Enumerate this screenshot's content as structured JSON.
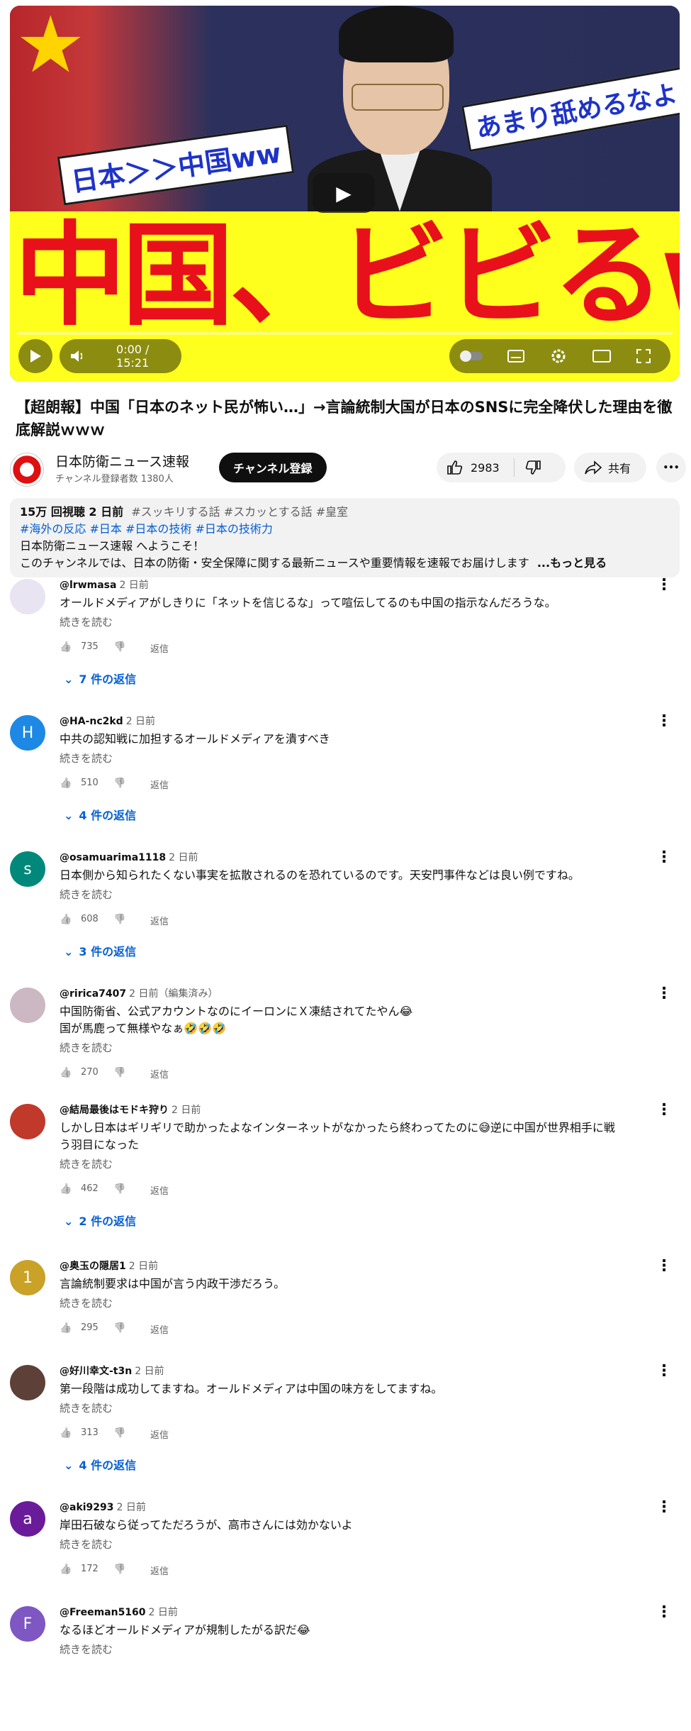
{
  "video": {
    "flag_glyph": "★",
    "tag_left": "日本＞＞中国ww",
    "tag_right": "あまり舐めるなよ！",
    "banner_text": "中国、ビビるww",
    "play_glyph": "▶",
    "time": "0:00 / 15:21"
  },
  "title": "【超朗報】中国「日本のネット民が怖い…」→言論統制大国が日本のSNSに完全降伏した理由を徹底解説ｗｗｗ",
  "channel": {
    "name": "日本防衛ニュース速報",
    "subscribers": "チャンネル登録者数 1380人",
    "subscribe_label": "チャンネル登録",
    "likes": "2983",
    "share_label": "共有",
    "more_glyph": "•••"
  },
  "description": {
    "stats": "15万 回視聴  2 日前",
    "tags_line1": "#スッキリする話 #スカッとする話 #皇室",
    "tags_line2": "#海外の反応 #日本 #日本の技術 #日本の技術力",
    "line3": "日本防衛ニュース速報 へようこそ！",
    "line4": " このチャンネルでは、日本の防衛・安全保障に関する最新ニュースや重要情報を速報でお届けします",
    "more": "...もっと見る"
  },
  "comment_ui": {
    "read_more": "続きを読む",
    "reply_label": "返信",
    "kebab": "⋮",
    "like_icon": "👍",
    "dislike_icon": "👎",
    "chevron": "⌄"
  },
  "comments": [
    {
      "user": "@lrwmasa",
      "ago": "2 日前",
      "text": "オールドメディアがしきりに「ネットを信じるな」って喧伝してるのも中国の指示なんだろうな。",
      "likes": "735",
      "replies": "7 件の返信",
      "avatar": "",
      "avatar_color": "#e9e4f2"
    },
    {
      "user": "@HA-nc2kd",
      "ago": "2 日前",
      "text": "中共の認知戦に加担するオールドメディアを潰すべき",
      "likes": "510",
      "replies": "4 件の返信",
      "avatar": "H",
      "avatar_color": "#1e88e5"
    },
    {
      "user": "@osamuarima1118",
      "ago": "2 日前",
      "text": "日本側から知られたくない事実を拡散されるのを恐れているのです。天安門事件などは良い例ですね。",
      "likes": "608",
      "replies": "3 件の返信",
      "avatar": "s",
      "avatar_color": "#00897b"
    },
    {
      "user": "@ririca7407",
      "ago": "2 日前（編集済み）",
      "text": "中国防衛省、公式アカウントなのにイーロンにＸ凍結されてたやん😂",
      "text2": "国が馬鹿って無様やなぁ🤣🤣🤣",
      "likes": "270",
      "replies": "",
      "avatar": "",
      "avatar_color": "#cbb8c2"
    },
    {
      "user": "@結局最後はモドキ狩り",
      "ago": "2 日前",
      "text": "しかし日本はギリギリで助かったよなインターネットがなかったら終わってたのに😅逆に中国が世界相手に戦",
      "text2": "う羽目になった",
      "likes": "462",
      "replies": "2 件の返信",
      "avatar": "",
      "avatar_color": "#c0392b"
    },
    {
      "user": "@奥玉の隠居1",
      "ago": "2 日前",
      "text": "言論統制要求は中国が言う内政干渉だろう。",
      "likes": "295",
      "replies": "",
      "avatar": "1",
      "avatar_color": "#c9a227"
    },
    {
      "user": "@好川幸文-t3n",
      "ago": "2 日前",
      "text": "第一段階は成功してますね。オールドメディアは中国の味方をしてますね。",
      "likes": "313",
      "replies": "4 件の返信",
      "avatar": "",
      "avatar_color": "#5d4037"
    },
    {
      "user": "@aki9293",
      "ago": "2 日前",
      "text": "岸田石破なら従ってただろうが、高市さんには効かないよ",
      "likes": "172",
      "replies": "",
      "avatar": "a",
      "avatar_color": "#6a1b9a"
    },
    {
      "user": "@Freeman5160",
      "ago": "2 日前",
      "text": "なるほどオールドメディアが規制したがる訳だ😂",
      "likes": "",
      "replies": "",
      "avatar": "F",
      "avatar_color": "#7e57c2"
    }
  ]
}
